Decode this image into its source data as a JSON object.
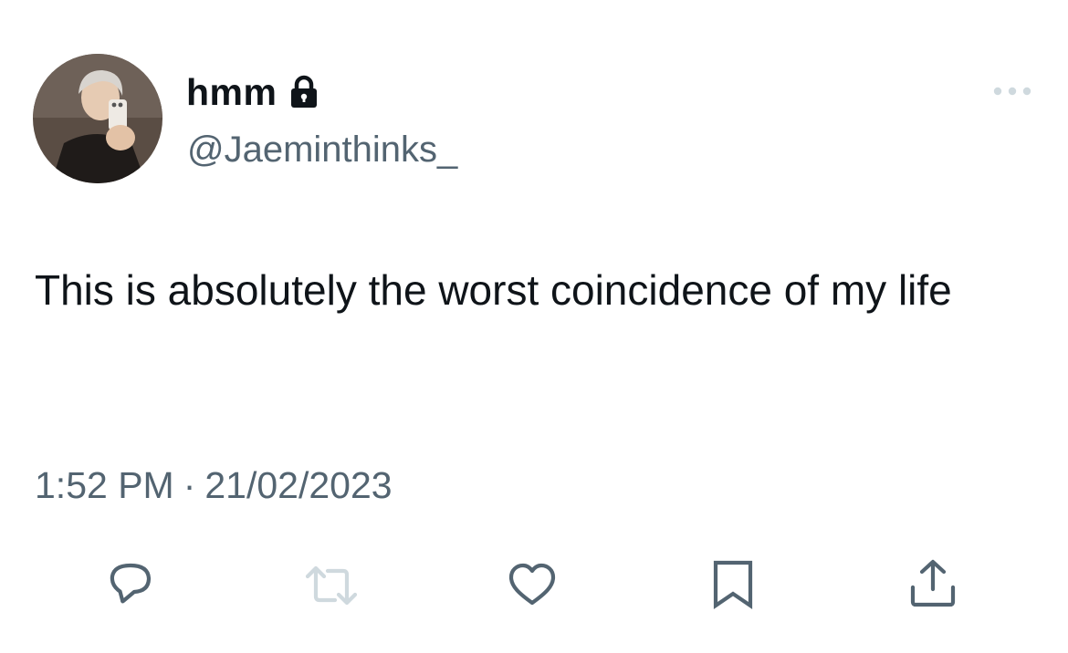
{
  "tweet": {
    "author": {
      "display_name": "hmm",
      "handle": "@Jaeminthinks_",
      "protected_icon": "lock-icon",
      "avatar": "profile-photo"
    },
    "more_icon": "more-dots-icon",
    "text": "This is absolutely the worst coincidence of my life",
    "time": "1:52 PM",
    "separator": "·",
    "date": "21/02/2023"
  },
  "actions": [
    {
      "name": "reply",
      "icon": "reply-icon"
    },
    {
      "name": "retweet",
      "icon": "retweet-icon",
      "disabled": true
    },
    {
      "name": "like",
      "icon": "heart-icon"
    },
    {
      "name": "bookmark",
      "icon": "bookmark-icon"
    },
    {
      "name": "share",
      "icon": "share-icon"
    }
  ],
  "colors": {
    "text_primary": "#0f1419",
    "text_secondary": "#536471",
    "icon_default": "#536471",
    "icon_disabled": "#cfd9de",
    "background": "#ffffff"
  }
}
